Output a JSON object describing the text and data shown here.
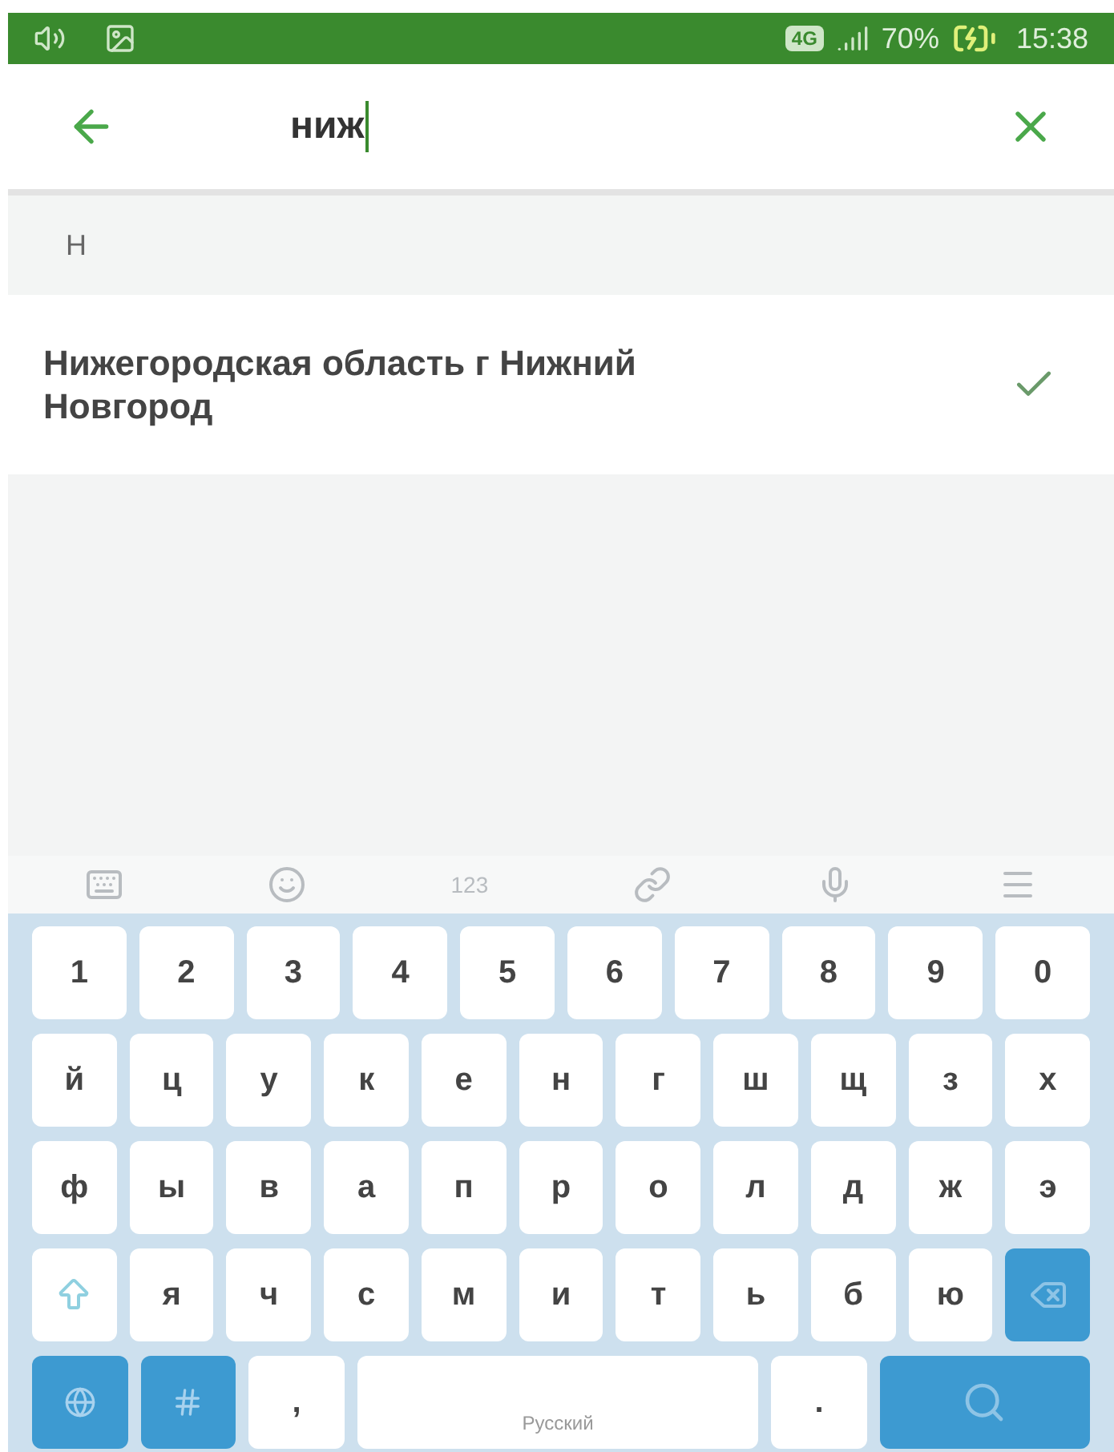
{
  "status_bar": {
    "network": "4G",
    "battery": "70%",
    "time": "15:38"
  },
  "search": {
    "value": "ниж"
  },
  "section": {
    "header": "Н"
  },
  "results": [
    {
      "label": "Нижегородская область г Нижний Новгород",
      "checked": true
    }
  ],
  "keyboard_toolbar": {
    "numbers_label": "123"
  },
  "keyboard_rows": [
    {
      "keys": [
        {
          "kind": "char",
          "label": "1"
        },
        {
          "kind": "char",
          "label": "2"
        },
        {
          "kind": "char",
          "label": "3"
        },
        {
          "kind": "char",
          "label": "4"
        },
        {
          "kind": "char",
          "label": "5"
        },
        {
          "kind": "char",
          "label": "6"
        },
        {
          "kind": "char",
          "label": "7"
        },
        {
          "kind": "char",
          "label": "8"
        },
        {
          "kind": "char",
          "label": "9"
        },
        {
          "kind": "char",
          "label": "0"
        }
      ]
    },
    {
      "keys": [
        {
          "kind": "char",
          "label": "й"
        },
        {
          "kind": "char",
          "label": "ц"
        },
        {
          "kind": "char",
          "label": "у"
        },
        {
          "kind": "char",
          "label": "к"
        },
        {
          "kind": "char",
          "label": "е"
        },
        {
          "kind": "char",
          "label": "н"
        },
        {
          "kind": "char",
          "label": "г"
        },
        {
          "kind": "char",
          "label": "ш"
        },
        {
          "kind": "char",
          "label": "щ"
        },
        {
          "kind": "char",
          "label": "з"
        },
        {
          "kind": "char",
          "label": "х"
        }
      ]
    },
    {
      "keys": [
        {
          "kind": "char",
          "label": "ф"
        },
        {
          "kind": "char",
          "label": "ы"
        },
        {
          "kind": "char",
          "label": "в"
        },
        {
          "kind": "char",
          "label": "а"
        },
        {
          "kind": "char",
          "label": "п"
        },
        {
          "kind": "char",
          "label": "р"
        },
        {
          "kind": "char",
          "label": "о"
        },
        {
          "kind": "char",
          "label": "л"
        },
        {
          "kind": "char",
          "label": "д"
        },
        {
          "kind": "char",
          "label": "ж"
        },
        {
          "kind": "char",
          "label": "э"
        }
      ]
    },
    {
      "keys": [
        {
          "kind": "shift"
        },
        {
          "kind": "char",
          "label": "я"
        },
        {
          "kind": "char",
          "label": "ч"
        },
        {
          "kind": "char",
          "label": "с"
        },
        {
          "kind": "char",
          "label": "м"
        },
        {
          "kind": "char",
          "label": "и"
        },
        {
          "kind": "char",
          "label": "т"
        },
        {
          "kind": "char",
          "label": "ь"
        },
        {
          "kind": "char",
          "label": "б"
        },
        {
          "kind": "char",
          "label": "ю"
        },
        {
          "kind": "backspace"
        }
      ]
    },
    {
      "keys": [
        {
          "kind": "lang"
        },
        {
          "kind": "symbols"
        },
        {
          "kind": "char",
          "label": ","
        },
        {
          "kind": "space",
          "label": "Русский"
        },
        {
          "kind": "char",
          "label": "."
        },
        {
          "kind": "search"
        }
      ]
    }
  ]
}
